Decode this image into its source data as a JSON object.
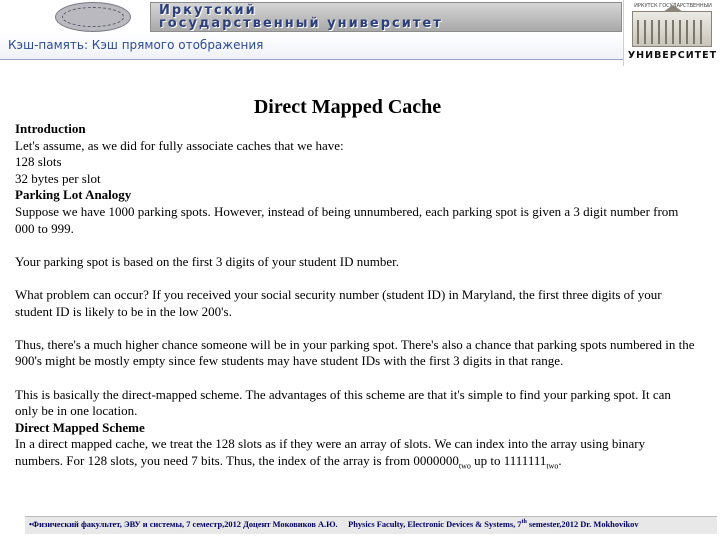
{
  "header": {
    "university_name_line1": "Иркутский",
    "university_name_line2": "государственный университет",
    "logo_caption_top": "ИРКУТСК ГОСУДАРСТВЕННЫЙ",
    "logo_caption_bottom": "УНИВЕРСИТЕТ"
  },
  "subtitle": "Кэш-память: Кэш прямого отображения",
  "slide": {
    "title": "Direct Mapped Cache",
    "intro_heading": "Introduction",
    "intro_lines": "Let's assume, as we did for fully associate caches that we have:\n128 slots\n32 bytes per slot",
    "parking_heading": "Parking Lot Analogy",
    "parking_p1": "Suppose we have 1000 parking spots. However, instead of being unnumbered, each parking spot is given a 3 digit number from 000 to 999.",
    "parking_p2": "Your parking spot is based on the first 3 digits of your student ID number.",
    "parking_p3": "What problem can occur? If you received your social security number (student ID) in Maryland, the first three digits of your student ID is likely to be in the low 200's.",
    "parking_p4": "Thus, there's a much higher chance someone will be in your parking spot. There's also a chance that parking spots numbered in the 900's might be mostly empty since few students may have student IDs with the first 3 digits in that range.",
    "parking_p5": "This is basically the direct-mapped scheme. The advantages of this scheme are that it's simple to find your parking spot. It can only be in one location.",
    "scheme_heading": "Direct Mapped Scheme",
    "scheme_p1_pre": "In a direct mapped cache, we treat the 128 slots as if they were an array of slots. We can index into the array using binary numbers. For 128 slots, you need 7 bits. Thus, the index of the array is from ",
    "scheme_val_from": "0000000",
    "scheme_sub_from": "two",
    "scheme_mid": " up to ",
    "scheme_val_to": "1111111",
    "scheme_sub_to": "two",
    "scheme_end": "."
  },
  "footer": {
    "text_ru": "•Физический факультет, ЭВУ и системы, 7 семестр,2012 Доцент Моковиков А.Ю.",
    "text_en_pre": "Physics Faculty, Electronic Devices & Systems, 7",
    "text_en_sup": "th",
    "text_en_post": " semester,2012   Dr. Mokhovikov"
  }
}
